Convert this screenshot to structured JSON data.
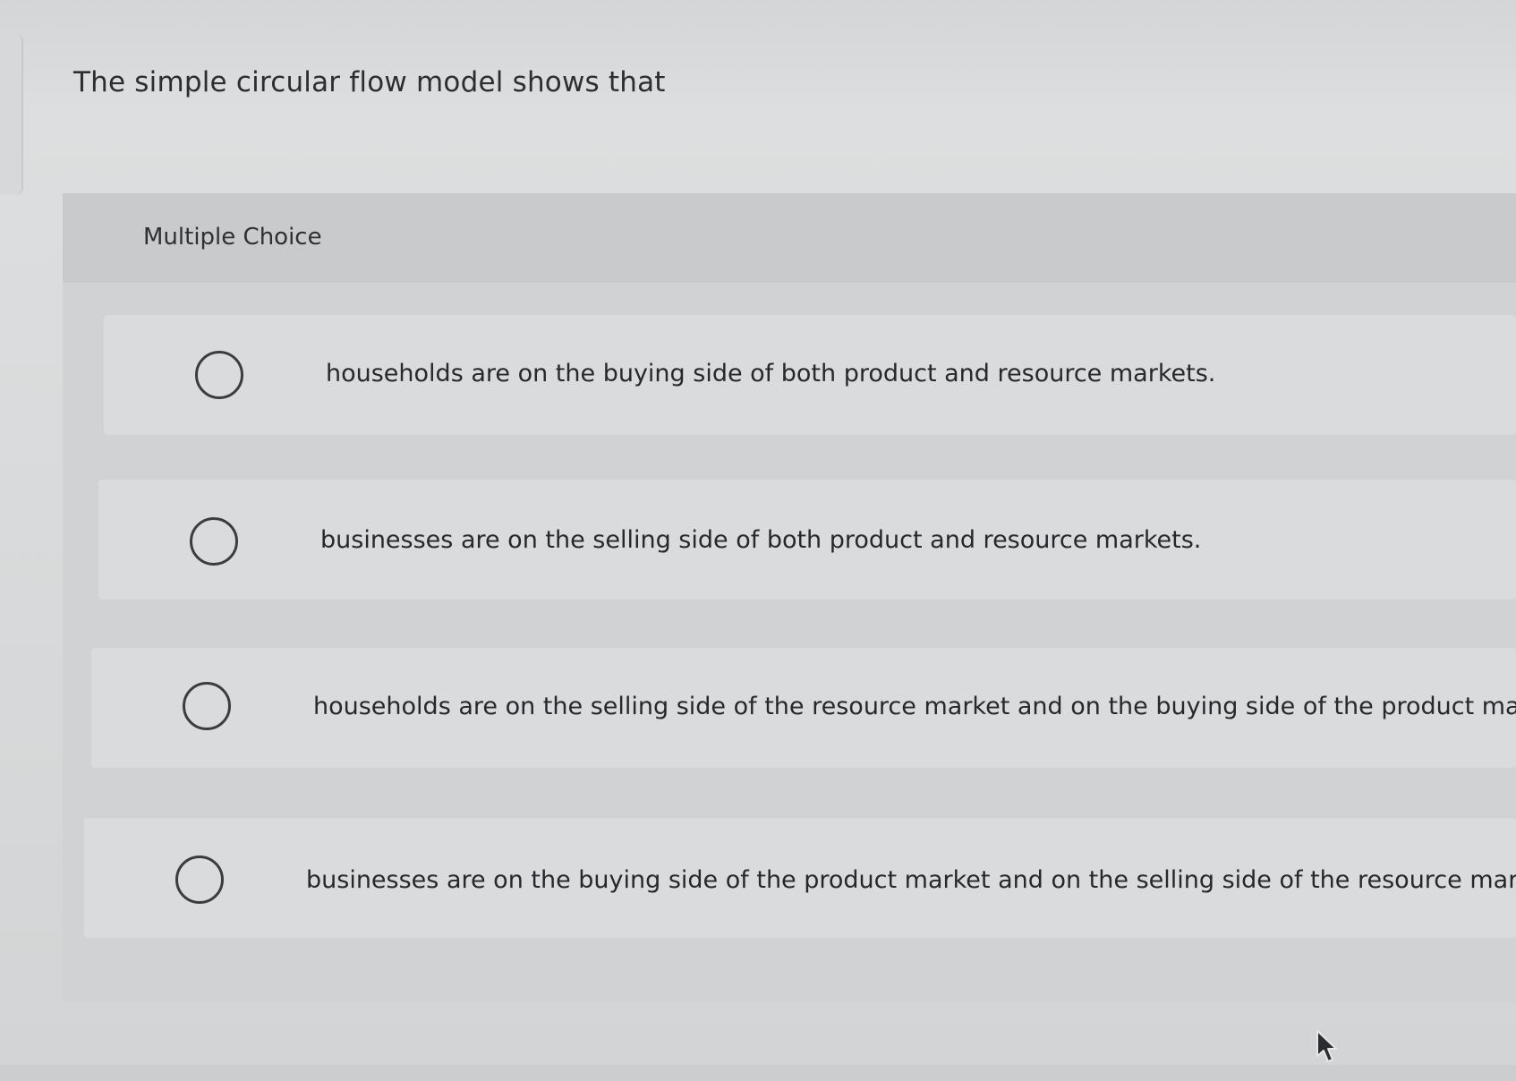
{
  "question": {
    "text": "The simple circular flow model shows that"
  },
  "multiple_choice": {
    "header_label": "Multiple Choice",
    "options": [
      {
        "label": "households are on the buying side of both product and resource markets.",
        "selected": false
      },
      {
        "label": "businesses are on the selling side of both product and resource markets.",
        "selected": false
      },
      {
        "label": "households are on the selling side of the resource market and on the buying side of the product market.",
        "selected": false
      },
      {
        "label": "businesses are on the buying side of the product market and on the selling side of the resource market.",
        "selected": false
      }
    ]
  },
  "icons": {
    "radio": "radio-circle-icon",
    "cursor": "mouse-pointer-icon"
  },
  "colors": {
    "text": "#2b2d30",
    "panel": "#d0d2d4",
    "header": "#c8cacc",
    "option_bg": "#d9dbdd",
    "radio_border": "#3a3c3f"
  }
}
